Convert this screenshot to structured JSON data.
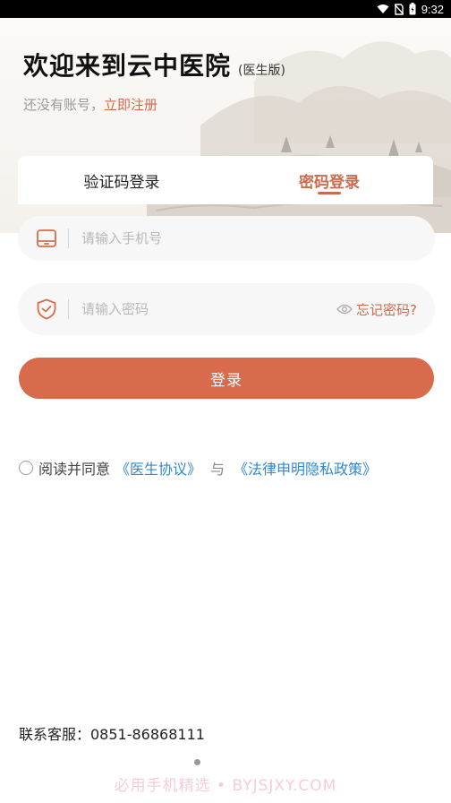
{
  "status_bar": {
    "time": "9:32"
  },
  "header": {
    "title": "欢迎来到云中医院",
    "edition": "(医生版)",
    "no_account_text": "还没有账号，",
    "register_link": "立即注册"
  },
  "tabs": [
    {
      "label": "验证码登录",
      "active": false
    },
    {
      "label": "密码登录",
      "active": true
    }
  ],
  "form": {
    "phone_placeholder": "请输入手机号",
    "password_placeholder": "请输入密码",
    "forgot_label": "忘记密码?",
    "login_label": "登录"
  },
  "agreement": {
    "prefix": "阅读并同意",
    "doctor_agreement": "《医生协议》",
    "and": "与",
    "privacy_policy": "《法律申明隐私政策》"
  },
  "footer": {
    "contact": "联系客服：0851-86868111",
    "watermark": "必用手机精选 • BYJSJXY.COM"
  },
  "colors": {
    "accent": "#d86b4b",
    "link_blue": "#2f88d1",
    "field_bg": "#f7f7f7"
  },
  "icons": {
    "phone_field": "phone-tablet-icon",
    "password_field": "shield-check-icon",
    "forgot": "eye-icon"
  }
}
